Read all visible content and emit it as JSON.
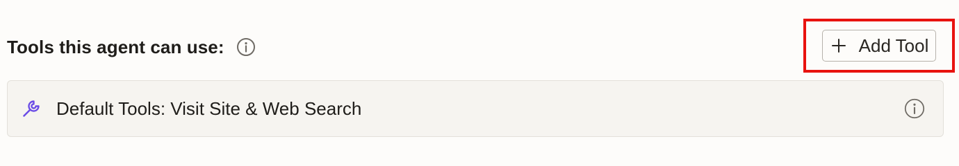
{
  "section": {
    "title": "Tools this agent can use:",
    "info_icon": "info-icon"
  },
  "add_tool_button": {
    "label": "Add Tool",
    "icon": "plus-icon",
    "highlighted": true,
    "highlight_color": "#e8130f"
  },
  "tools": [
    {
      "label": "Default Tools: Visit Site & Web Search",
      "icon": "wrench-icon",
      "icon_color": "#6b4de6",
      "info_icon": "info-icon"
    }
  ]
}
